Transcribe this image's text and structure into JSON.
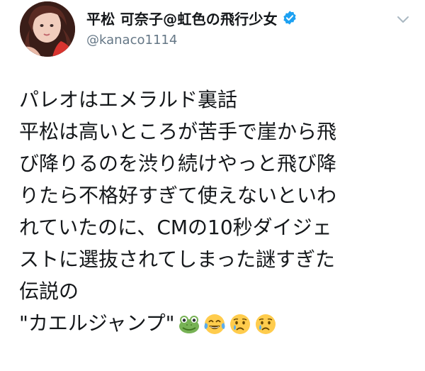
{
  "author": {
    "display_name": "平松 可奈子@虹色の飛行少女",
    "handle": "@kanaco1114",
    "verified": true,
    "avatar_icon": "profile-photo"
  },
  "menu": {
    "icon": "chevron-down-icon"
  },
  "tweet": {
    "lines": [
      "パレオはエメラルド裏話",
      "平松は高いところが苦手で崖から飛",
      "び降りるのを渋り続けやっと飛び降",
      "りたら不格好すぎて使えないといわ",
      "れていたのに、CMの10秒ダイジェ",
      "ストに選抜されてしまった謎すぎた",
      "伝説の",
      "\"カエルジャンプ\""
    ],
    "emojis": [
      "frog-face-icon",
      "tears-of-joy-icon",
      "crying-face-icon",
      "crying-face-icon"
    ]
  },
  "colors": {
    "text": "#14171a",
    "secondary": "#657786",
    "verified": "#1da1f2"
  }
}
